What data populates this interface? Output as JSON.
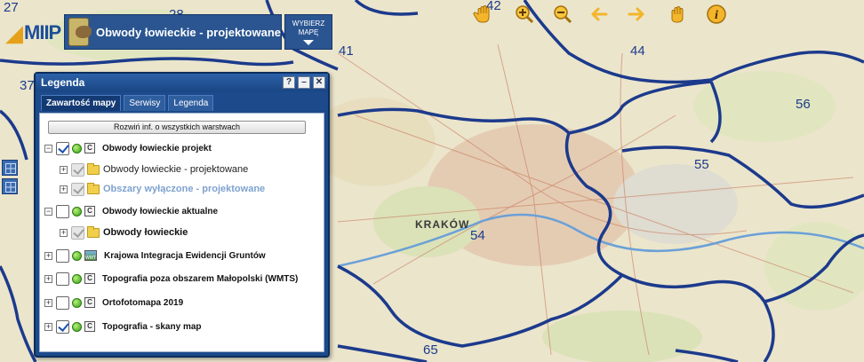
{
  "app": {
    "logo_text": "MIIP",
    "title": "Obwody łowieckie - projektowane",
    "choose_map_label_1": "WYBIERZ",
    "choose_map_label_2": "MAPĘ"
  },
  "toolbar": {
    "icons": [
      "hand-pan-icon",
      "zoom-in-icon",
      "zoom-out-icon",
      "back-arrow-icon",
      "forward-arrow-icon",
      "select-hand-icon",
      "info-icon"
    ]
  },
  "map": {
    "district_numbers": [
      "27",
      "28",
      "42",
      "37",
      "41",
      "44",
      "56",
      "55",
      "54",
      "65"
    ],
    "city_label": "KRAKÓW",
    "colors": {
      "boundary": "#1c3a8c",
      "background": "#e8e2c8"
    }
  },
  "legend": {
    "title": "Legenda",
    "window_buttons": [
      "?",
      "–",
      "✕"
    ],
    "tabs": [
      "Zawartość mapy",
      "Serwisy",
      "Legenda"
    ],
    "expand_all_label": "Rozwiń inf. o wszystkich warstwach",
    "layers": [
      {
        "label": "Obwody łowieckie projekt",
        "checked": true,
        "expanded": true
      },
      {
        "label": "Obwody łowieckie - projektowane",
        "sublayer": true
      },
      {
        "label": "Obszary wyłączone - projektowane",
        "sublayer": true,
        "disabled": true
      },
      {
        "label": "Obwody łowieckie aktualne",
        "checked": false,
        "expanded": true
      },
      {
        "label": "Obwody łowieckie",
        "sublayer": true
      },
      {
        "label": "Krajowa Integracja Ewidencji Gruntów",
        "checked": false,
        "icon": "WMTS"
      },
      {
        "label": "Topografia poza obszarem Małopolski (WMTS)",
        "checked": false
      },
      {
        "label": "Ortofotomapa 2019",
        "checked": false
      },
      {
        "label": "Topografia - skany map",
        "checked": true
      }
    ]
  }
}
